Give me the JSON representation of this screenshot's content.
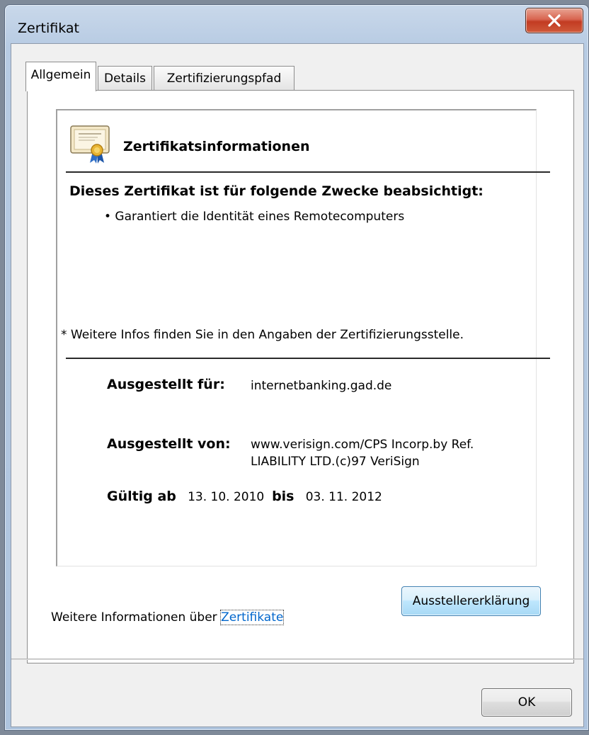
{
  "window": {
    "title": "Zertifikat"
  },
  "tabs": [
    {
      "label": "Allgemein",
      "active": true
    },
    {
      "label": "Details",
      "active": false
    },
    {
      "label": "Zertifizierungspfad",
      "active": false
    }
  ],
  "info": {
    "title": "Zertifikatsinformationen",
    "purpose_heading": "Dieses Zertifikat ist für folgende Zwecke beabsichtigt:",
    "purposes": [
      "• Garantiert die Identität eines Remotecomputers"
    ],
    "footnote": "* Weitere Infos finden Sie in den Angaben der Zertifizierungsstelle.",
    "issued_to_label": "Ausgestellt für:",
    "issued_to_value": "internetbanking.gad.de",
    "issued_by_label": "Ausgestellt von:",
    "issued_by_line1": "www.verisign.com/CPS Incorp.by Ref.",
    "issued_by_line2": "LIABILITY LTD.(c)97 VeriSign",
    "valid_from_label": "Gültig ab",
    "valid_from": "13. 10. 2010",
    "valid_to_label": "bis",
    "valid_to": "03. 11. 2012"
  },
  "buttons": {
    "issuer_statement": "Ausstellererklärung",
    "ok": "OK"
  },
  "more_info": {
    "text": "Weitere Informationen über ",
    "link": "Zertifikate"
  },
  "colors": {
    "close_button": "#c23b22",
    "link": "#0066cc",
    "focused_button": "#bee6fd"
  },
  "icons": {
    "certificate": "certificate-icon",
    "close": "close-icon"
  }
}
